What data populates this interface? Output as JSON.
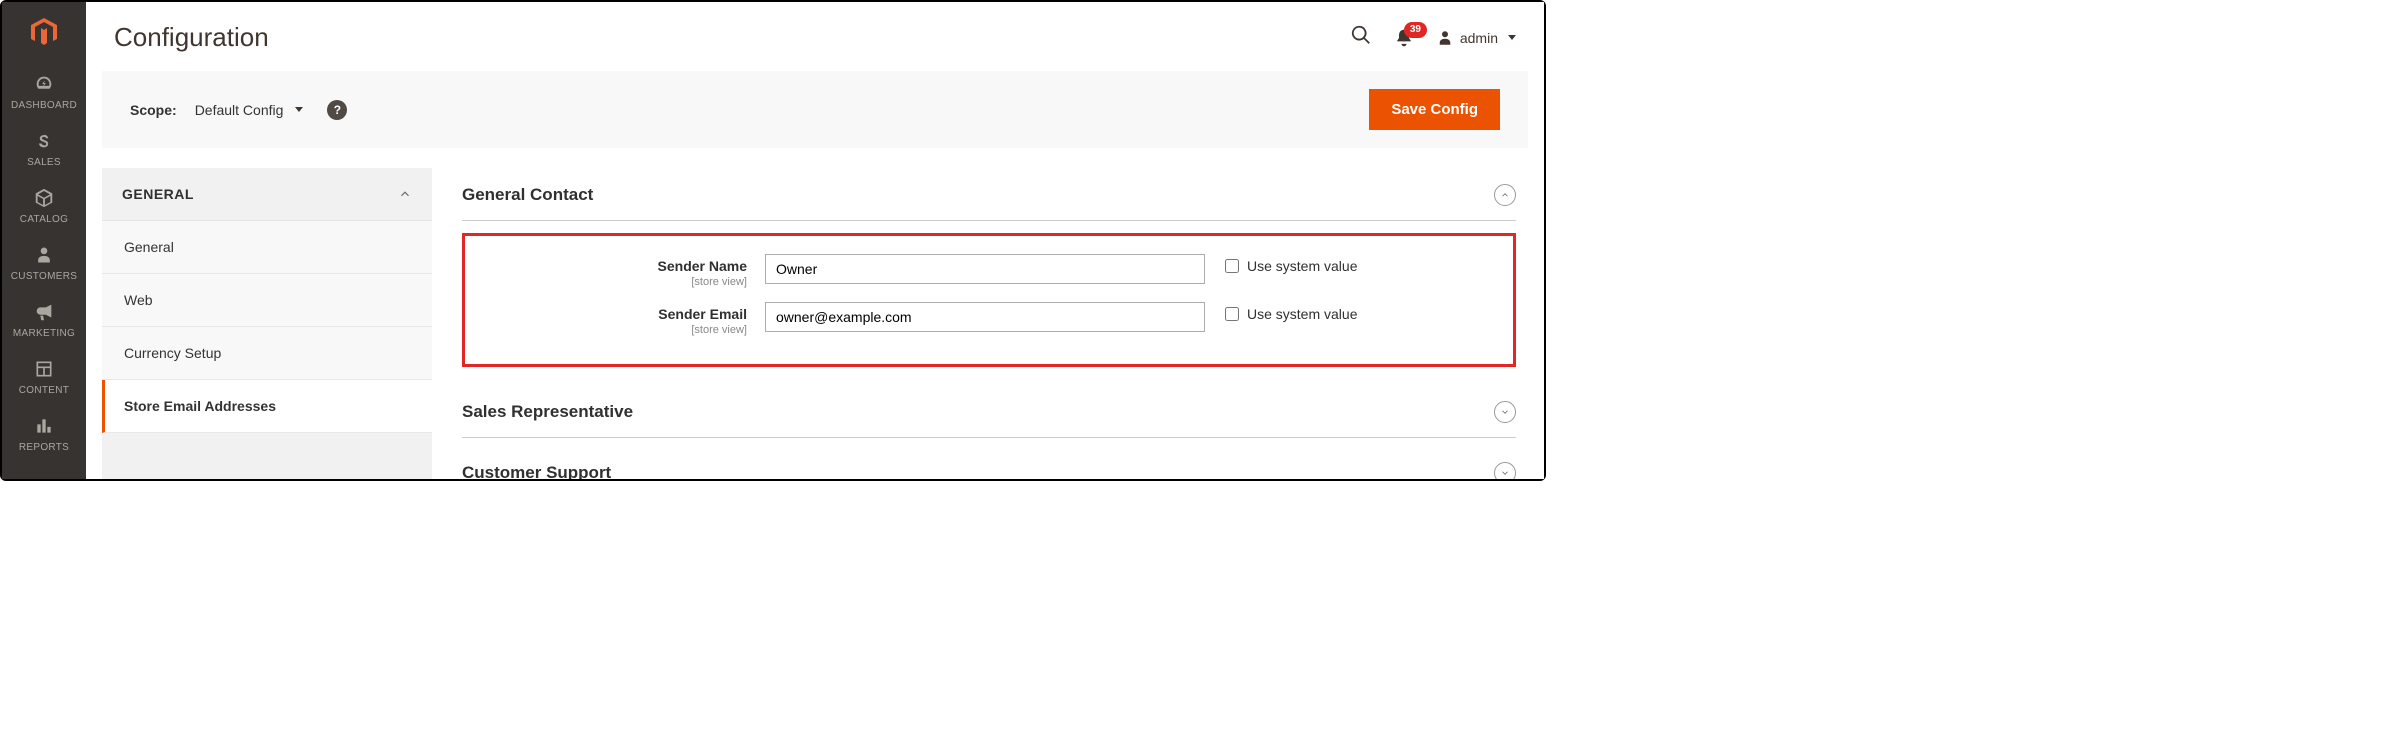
{
  "header": {
    "page_title": "Configuration",
    "notif_count": "39",
    "user_label": "admin"
  },
  "scope": {
    "label": "Scope:",
    "value": "Default Config",
    "save_label": "Save Config"
  },
  "sidebar": [
    {
      "label": "DASHBOARD"
    },
    {
      "label": "SALES"
    },
    {
      "label": "CATALOG"
    },
    {
      "label": "CUSTOMERS"
    },
    {
      "label": "MARKETING"
    },
    {
      "label": "CONTENT"
    },
    {
      "label": "REPORTS"
    }
  ],
  "config_nav": {
    "group_label": "GENERAL",
    "items": [
      {
        "label": "General"
      },
      {
        "label": "Web"
      },
      {
        "label": "Currency Setup"
      },
      {
        "label": "Store Email Addresses",
        "active": true
      }
    ]
  },
  "sections": {
    "general_contact": {
      "title": "General Contact",
      "sender_name_label": "Sender Name",
      "sender_name_value": "Owner",
      "sender_email_label": "Sender Email",
      "sender_email_value": "owner@example.com",
      "scope_hint": "[store view]",
      "use_system_label": "Use system value"
    },
    "sales_rep": {
      "title": "Sales Representative"
    },
    "customer_support": {
      "title": "Customer Support"
    }
  }
}
